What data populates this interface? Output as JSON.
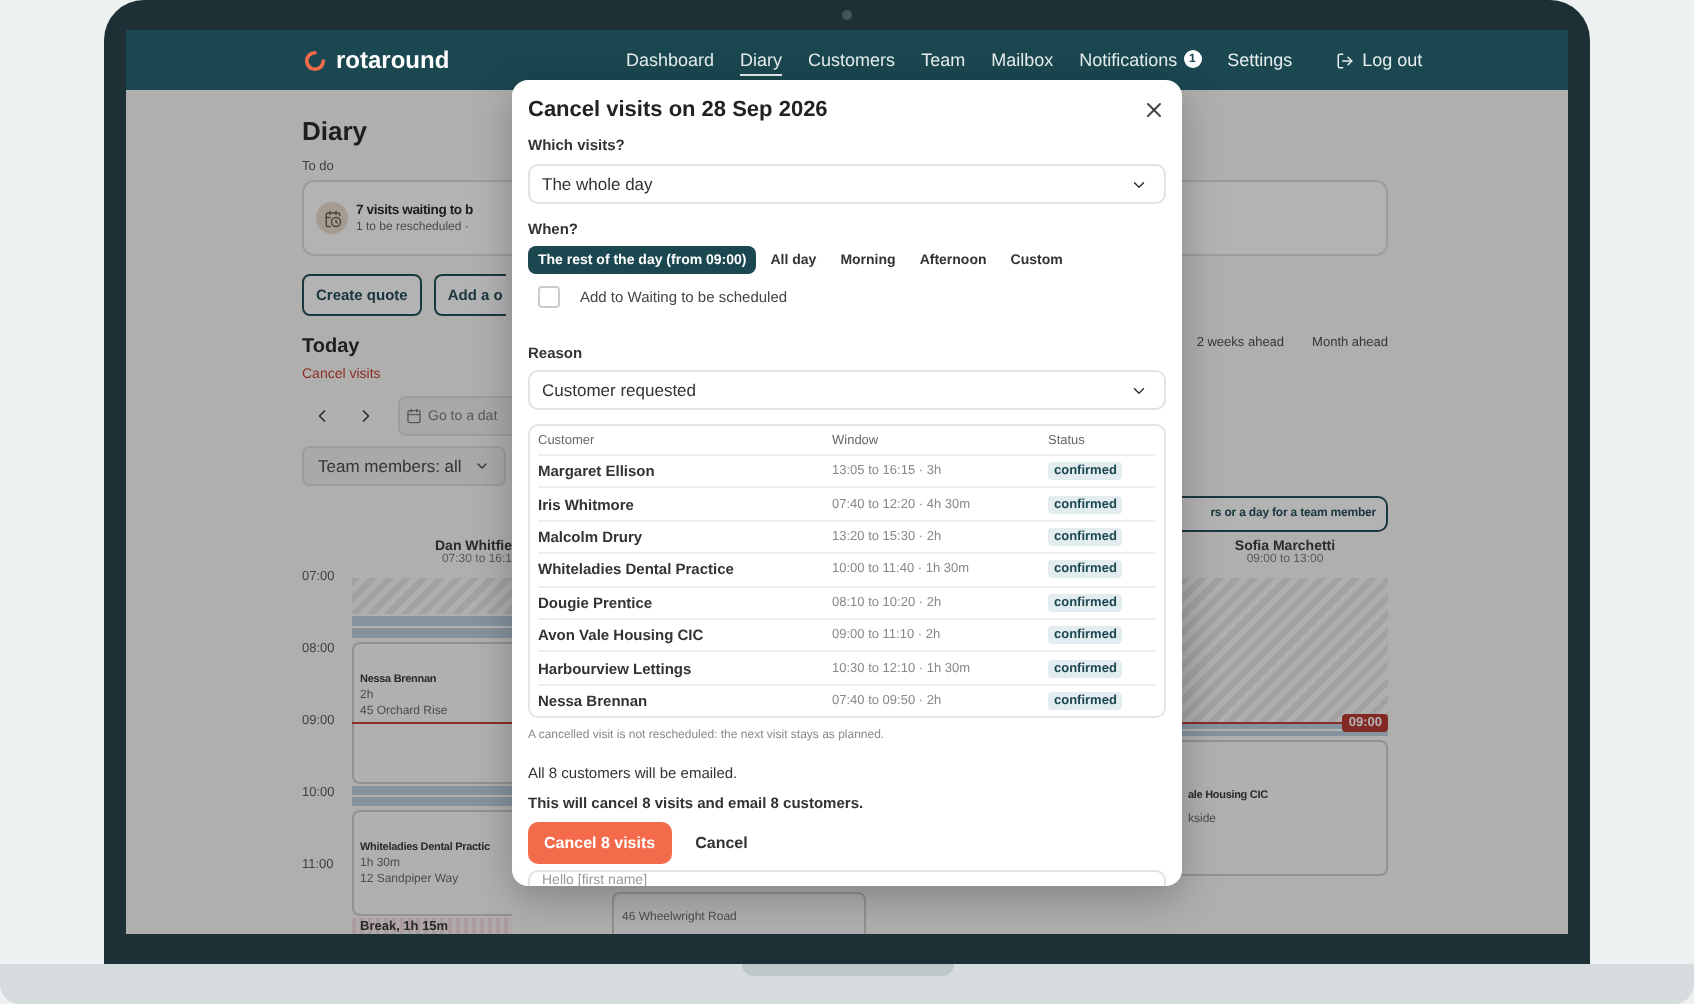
{
  "nav": {
    "logo": "rotaround",
    "items": [
      {
        "label": "Dashboard",
        "selected": false
      },
      {
        "label": "Diary",
        "selected": true
      },
      {
        "label": "Customers",
        "selected": false
      },
      {
        "label": "Team",
        "selected": false
      },
      {
        "label": "Mailbox",
        "selected": false
      },
      {
        "label": "Notifications",
        "selected": false,
        "badge": "1"
      },
      {
        "label": "Settings",
        "selected": false
      }
    ],
    "logout": "Log out"
  },
  "page": {
    "title": "Diary",
    "todo_label": "To do",
    "todo_card": {
      "title": "7 visits waiting to b",
      "subtitle": "1 to be rescheduled ·"
    },
    "buttons": [
      "Create quote",
      "Add a o"
    ],
    "section": "Today",
    "cancel_link": "Cancel visits",
    "date_field": {
      "placeholder": "Go to a dat"
    },
    "team_filter": "Team members: all",
    "ranges": [
      "2 weeks ahead",
      "Month ahead"
    ],
    "team_button": "rs or a day for a team member"
  },
  "calendar": {
    "hours": [
      "07:00",
      "08:00",
      "09:00",
      "10:00",
      "11:00"
    ],
    "now": "09:00",
    "left_column": {
      "name": "Dan Whitfie",
      "hours": "07:30 to 16:1",
      "events": [
        {
          "kind": "visit",
          "title": "Nessa Brennan",
          "duration": "2h",
          "address": "45 Orchard Rise"
        },
        {
          "kind": "visit",
          "title": "Whiteladies Dental Practic",
          "duration": "1h 30m",
          "address": "12 Sandpiper Way"
        },
        {
          "kind": "break",
          "title": "Break, 1h 15m"
        }
      ]
    },
    "middle_event": {
      "address": "46 Wheelwright Road"
    },
    "right_column": {
      "name": "Sofia Marchetti",
      "hours": "09:00 to 13:00",
      "event": {
        "title": "ale Housing CIC",
        "address": "kside"
      }
    }
  },
  "modal": {
    "title": "Cancel visits on 28 Sep 2026",
    "which_label": "Which visits?",
    "which_value": "The whole day",
    "when_label": "When?",
    "when_options": [
      {
        "label": "The rest of the day (from 09:00)",
        "selected": true
      },
      {
        "label": "All day",
        "selected": false
      },
      {
        "label": "Morning",
        "selected": false
      },
      {
        "label": "Afternoon",
        "selected": false
      },
      {
        "label": "Custom",
        "selected": false
      }
    ],
    "add_to_waiting": {
      "label": "Add to Waiting to be scheduled",
      "checked": false
    },
    "reason_label": "Reason",
    "reason_value": "Customer requested",
    "table": {
      "columns": [
        "Customer",
        "Window",
        "Status"
      ],
      "rows": [
        {
          "customer": "Margaret Ellison",
          "window": "13:05 to 16:15 · 3h",
          "status": "confirmed"
        },
        {
          "customer": "Iris Whitmore",
          "window": "07:40 to 12:20 · 4h 30m",
          "status": "confirmed"
        },
        {
          "customer": "Malcolm Drury",
          "window": "13:20 to 15:30 · 2h",
          "status": "confirmed"
        },
        {
          "customer": "Whiteladies Dental Practice",
          "window": "10:00 to 11:40 · 1h 30m",
          "status": "confirmed"
        },
        {
          "customer": "Dougie Prentice",
          "window": "08:10 to 10:20 · 2h",
          "status": "confirmed"
        },
        {
          "customer": "Avon Vale Housing CIC",
          "window": "09:00 to 11:10 · 2h",
          "status": "confirmed"
        },
        {
          "customer": "Harbourview Lettings",
          "window": "10:30 to 12:10 · 1h 30m",
          "status": "confirmed"
        },
        {
          "customer": "Nessa Brennan",
          "window": "07:40 to 09:50 · 2h",
          "status": "confirmed"
        }
      ]
    },
    "note": "A cancelled visit is not rescheduled: the next visit stays as planned.",
    "email_note": "All 8 customers will be emailed.",
    "summary": "This will cancel 8 visits and email 8 customers.",
    "confirm_button": "Cancel 8 visits",
    "cancel_button": "Cancel",
    "message": "Hello [first name]"
  }
}
